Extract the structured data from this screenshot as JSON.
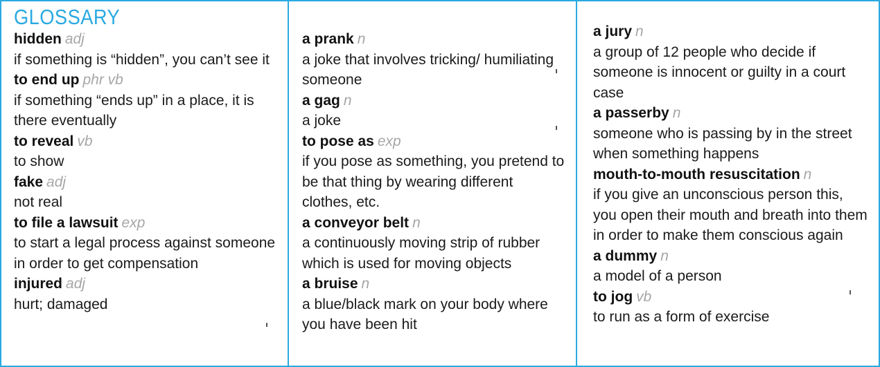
{
  "title": "GLOSSARY",
  "colors": {
    "accent": "#29a9e1",
    "pos_text": "#a6a6a6",
    "text": "#1a1a1a"
  },
  "columns": [
    {
      "entries": [
        {
          "term": "hidden",
          "pos": "adj",
          "definition": "if something is “hidden”, you can’t see it"
        },
        {
          "term": "to end up",
          "pos": "phr vb",
          "definition": "if something “ends up” in a place, it is there eventually"
        },
        {
          "term": "to reveal",
          "pos": "vb",
          "definition": "to show"
        },
        {
          "term": "fake",
          "pos": "adj",
          "definition": "not real"
        },
        {
          "term": "to file a lawsuit",
          "pos": "exp",
          "definition": "to start a legal process against someone  in order to get compensation"
        },
        {
          "term": "injured",
          "pos": "adj",
          "definition": "hurt; damaged"
        }
      ]
    },
    {
      "entries": [
        {
          "term": "a prank",
          "pos": "n",
          "definition": "a joke that involves tricking/ humiliating someone"
        },
        {
          "term": "a gag",
          "pos": "n",
          "definition": "a joke"
        },
        {
          "term": "to pose as",
          "pos": "exp",
          "definition": "if you pose as something, you pretend to be that thing by wearing different clothes, etc."
        },
        {
          "term": "a conveyor belt",
          "pos": "n",
          "definition": "a continuously moving strip of rubber which is used for moving objects"
        },
        {
          "term": "a bruise",
          "pos": "n",
          "definition": "a blue/black mark on your body where you have been hit"
        }
      ]
    },
    {
      "entries": [
        {
          "term": "a jury",
          "pos": "n",
          "definition": "a group of 12 people who decide if someone is innocent or guilty in a court case"
        },
        {
          "term": "a passerby",
          "pos": "n",
          "definition": "someone who is passing by in the street when something happens"
        },
        {
          "term": "mouth-to-mouth resuscitation",
          "pos": "n",
          "definition": "if you give an unconscious person this, you open their mouth and breath into them in order to make them conscious again"
        },
        {
          "term": "a dummy",
          "pos": "n",
          "definition": "a model of a person"
        },
        {
          "term": "to jog",
          "pos": "vb",
          "definition": "to run as a form of exercise"
        }
      ]
    }
  ]
}
